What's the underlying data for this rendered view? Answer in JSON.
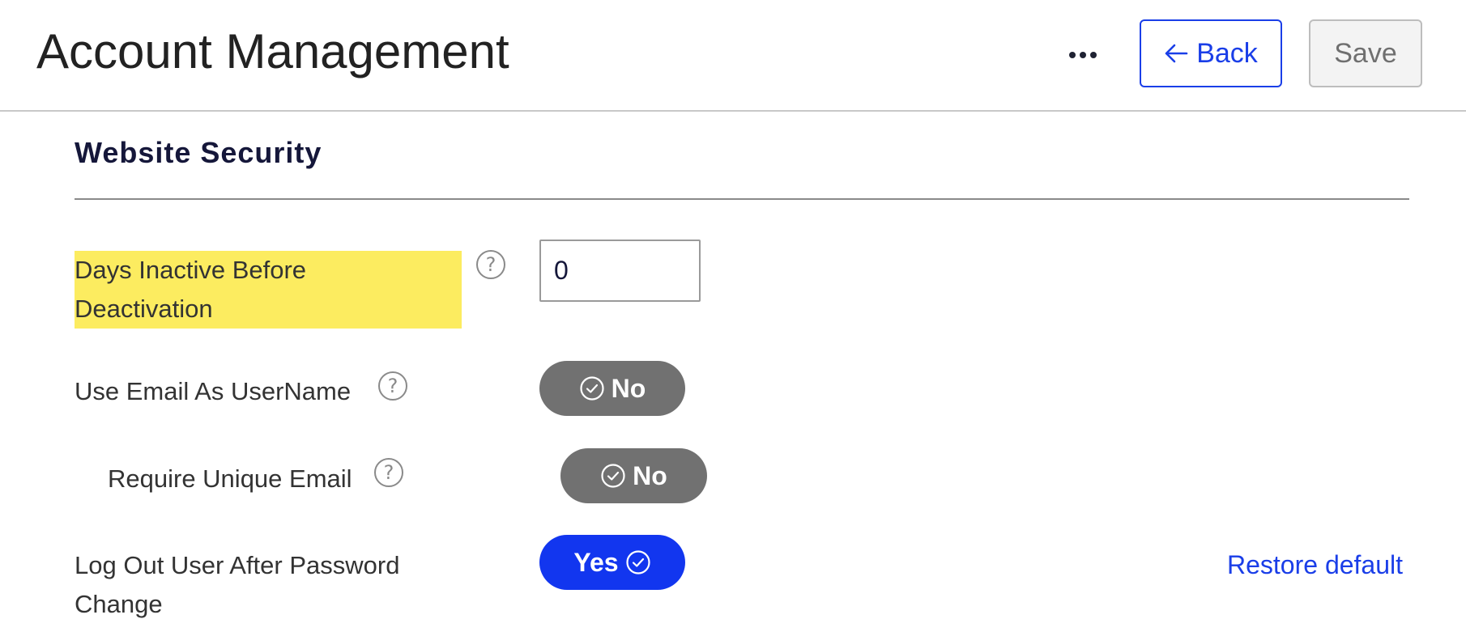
{
  "header": {
    "title": "Account Management",
    "more_icon": "ellipsis-icon",
    "back_label": "Back",
    "back_icon": "arrow-left-icon",
    "save_label": "Save"
  },
  "section": {
    "title": "Website Security"
  },
  "fields": {
    "days_inactive": {
      "label_line1": "Days Inactive Before",
      "label_line2": "Deactivation",
      "value": "0",
      "help_icon": "question-mark-icon"
    },
    "use_email_as_username": {
      "label": "Use Email As UserName",
      "toggle_label": "No",
      "toggle_state": "off",
      "help_icon": "question-mark-icon"
    },
    "require_unique_email": {
      "label": "Require Unique Email",
      "toggle_label": "No",
      "toggle_state": "off",
      "help_icon": "question-mark-icon"
    },
    "logout_after_password_change": {
      "label_line1": "Log Out User After Password",
      "label_line2": "Change",
      "toggle_label": "Yes",
      "toggle_state": "on",
      "restore_label": "Restore default"
    }
  },
  "colors": {
    "accent": "#1a3ee8",
    "toggle_on": "#1236ef",
    "toggle_off": "#717171",
    "highlight": "#fcec60"
  }
}
